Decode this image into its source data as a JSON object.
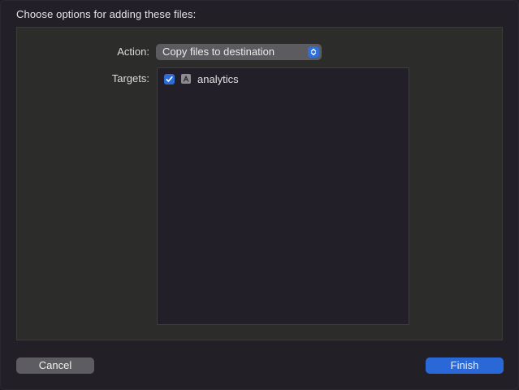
{
  "dialog": {
    "heading": "Choose options for adding these files:"
  },
  "action": {
    "label": "Action:",
    "selected": "Copy files to destination"
  },
  "targets": {
    "label": "Targets:",
    "items": [
      {
        "name": "analytics",
        "checked": true,
        "icon": "app-target-icon"
      }
    ]
  },
  "buttons": {
    "cancel": "Cancel",
    "finish": "Finish"
  },
  "colors": {
    "accent": "#2968d6",
    "background": "#221f27",
    "panel": "#2c2c2a"
  }
}
